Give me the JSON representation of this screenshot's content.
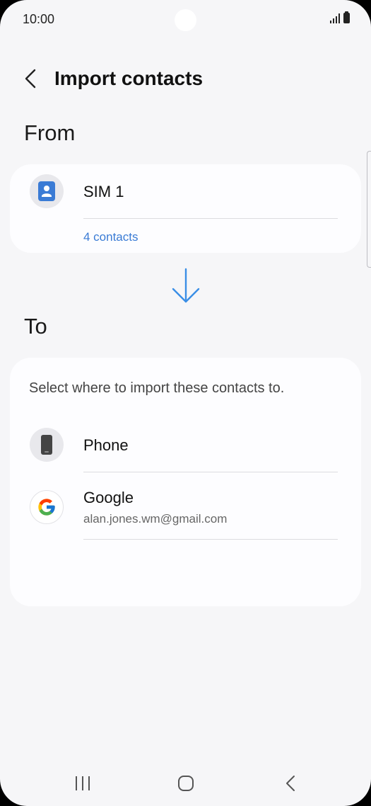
{
  "status_bar": {
    "time": "10:00"
  },
  "header": {
    "title": "Import contacts"
  },
  "from_section": {
    "label": "From",
    "source": {
      "name": "SIM 1",
      "count_link": "4 contacts"
    }
  },
  "to_section": {
    "label": "To",
    "hint": "Select where to import these contacts to.",
    "options": [
      {
        "name": "Phone"
      },
      {
        "name": "Google",
        "account": "alan.jones.wm@gmail.com"
      }
    ]
  },
  "colors": {
    "accent": "#3a7bd5",
    "sim_icon": "#3a7bd5",
    "arrow": "#3a8ee6",
    "background": "#f6f6f8",
    "card": "#fdfdff"
  },
  "icons": {
    "back": "chevron-left-icon",
    "sim": "contact-card-icon",
    "arrow": "arrow-down-icon",
    "phone": "phone-device-icon",
    "google": "google-logo-icon"
  }
}
